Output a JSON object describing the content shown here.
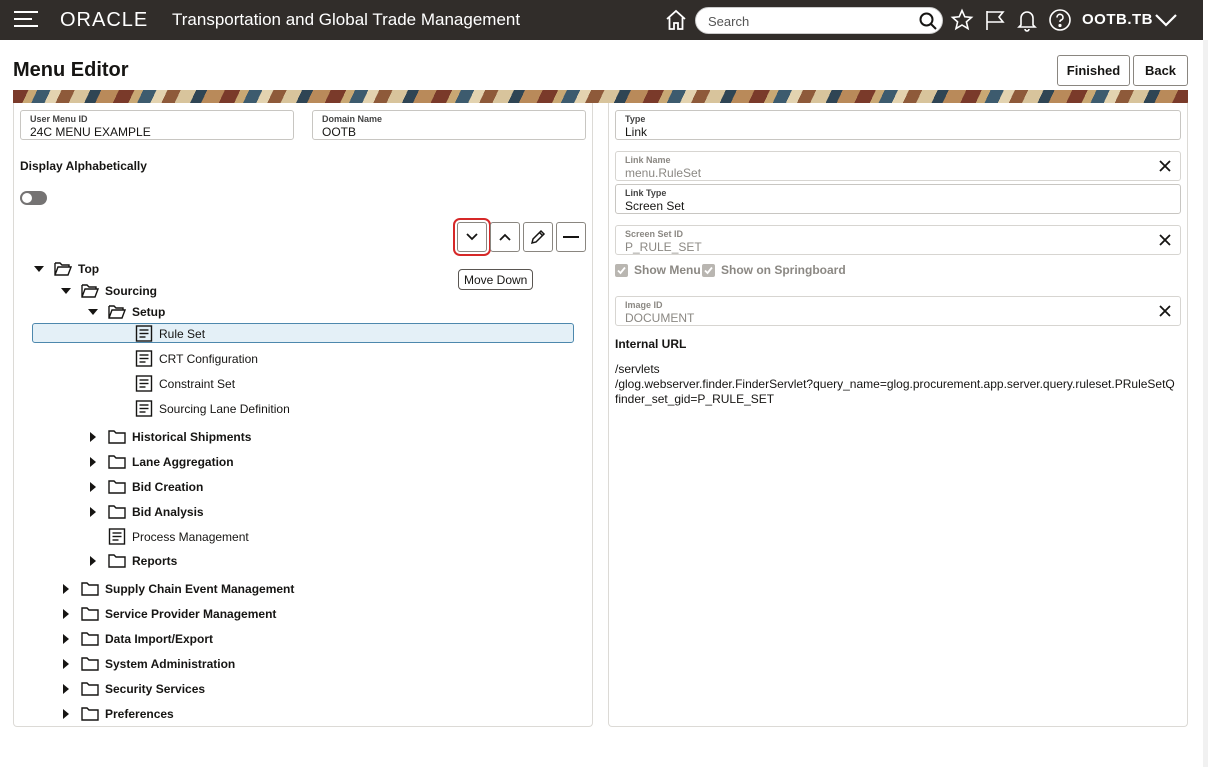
{
  "header": {
    "logo": "ORACLE",
    "app_title": "Transportation and Global Trade Management",
    "search_placeholder": "Search",
    "user": "OOTB.TB"
  },
  "page": {
    "title": "Menu Editor",
    "finished_label": "Finished",
    "back_label": "Back"
  },
  "left": {
    "user_menu_id": {
      "label": "User Menu ID",
      "value": "24C MENU EXAMPLE"
    },
    "domain_name": {
      "label": "Domain Name",
      "value": "OOTB"
    },
    "display_alpha_label": "Display Alphabetically",
    "display_alpha_on": false,
    "tooltip": "Move Down",
    "tree": [
      {
        "label": "Top",
        "level": 0,
        "type": "folder-open",
        "expanded": true
      },
      {
        "label": "Sourcing",
        "level": 1,
        "type": "folder-open",
        "expanded": true
      },
      {
        "label": "Setup",
        "level": 2,
        "type": "folder-open",
        "expanded": true
      },
      {
        "label": "Rule Set",
        "level": 3,
        "type": "link",
        "selected": true
      },
      {
        "label": "CRT Configuration",
        "level": 3,
        "type": "link"
      },
      {
        "label": "Constraint Set",
        "level": 3,
        "type": "link"
      },
      {
        "label": "Sourcing Lane Definition",
        "level": 3,
        "type": "link"
      },
      {
        "label": "Historical Shipments",
        "level": 2,
        "type": "folder",
        "expanded": false
      },
      {
        "label": "Lane Aggregation",
        "level": 2,
        "type": "folder",
        "expanded": false
      },
      {
        "label": "Bid Creation",
        "level": 2,
        "type": "folder",
        "expanded": false
      },
      {
        "label": "Bid Analysis",
        "level": 2,
        "type": "folder",
        "expanded": false
      },
      {
        "label": "Process Management",
        "level": 2,
        "type": "link"
      },
      {
        "label": "Reports",
        "level": 2,
        "type": "folder",
        "expanded": false
      },
      {
        "label": "Supply Chain Event Management",
        "level": 1,
        "type": "folder",
        "expanded": false
      },
      {
        "label": "Service Provider Management",
        "level": 1,
        "type": "folder",
        "expanded": false
      },
      {
        "label": "Data Import/Export",
        "level": 1,
        "type": "folder",
        "expanded": false
      },
      {
        "label": "System Administration",
        "level": 1,
        "type": "folder",
        "expanded": false
      },
      {
        "label": "Security Services",
        "level": 1,
        "type": "folder",
        "expanded": false
      },
      {
        "label": "Preferences",
        "level": 1,
        "type": "folder",
        "expanded": false
      }
    ]
  },
  "right": {
    "type": {
      "label": "Type",
      "value": "Link"
    },
    "link_name": {
      "label": "Link Name",
      "value": "menu.RuleSet"
    },
    "link_type": {
      "label": "Link Type",
      "value": "Screen Set"
    },
    "screen_set_id": {
      "label": "Screen Set ID",
      "value": "P_RULE_SET"
    },
    "show_menu_label": "Show Menu",
    "show_springboard_label": "Show on Springboard",
    "image_id": {
      "label": "Image ID",
      "value": "DOCUMENT"
    },
    "internal_url_label": "Internal URL",
    "internal_url_lines": [
      "/servlets",
      "/glog.webserver.finder.FinderServlet?query_name=glog.procurement.app.server.query.ruleset.PRuleSetQ",
      "finder_set_gid=P_RULE_SET"
    ]
  }
}
